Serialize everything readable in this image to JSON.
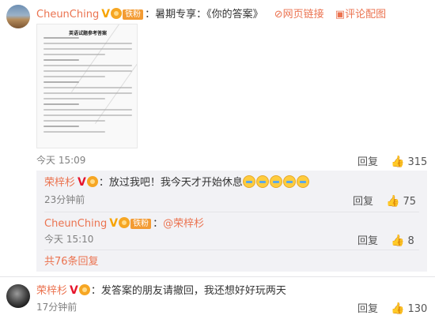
{
  "colors": {
    "username": "#eb7350",
    "fan_badge": "#f39b33",
    "sub_bg": "#f2f2f5"
  },
  "comment1": {
    "username": "CheunChing",
    "fan_badge": "铁粉",
    "text": "：暑期专享：《你的答案》",
    "link1_icon": "link-icon",
    "link1_label": "网页链接",
    "link2_icon": "image-icon",
    "link2_label": "评论配图",
    "image_title": "英语试题参考答案",
    "time": "今天 15:09",
    "reply_label": "回复",
    "likes": "315"
  },
  "reply1": {
    "username": "荣梓杉",
    "text": "：放过我吧！我今天才开始休息",
    "time": "23分钟前",
    "reply_label": "回复",
    "likes": "75"
  },
  "reply2": {
    "username": "CheunChing",
    "fan_badge": "铁粉",
    "text": "：",
    "mention": "@荣梓杉",
    "time": "今天 15:10",
    "reply_label": "回复",
    "likes": "8"
  },
  "more_replies": "共76条回复",
  "comment2": {
    "username": "荣梓杉",
    "text": "：发答案的朋友请撤回，我还想好好玩两天",
    "time": "17分钟前",
    "reply_label": "回复",
    "likes": "130"
  }
}
